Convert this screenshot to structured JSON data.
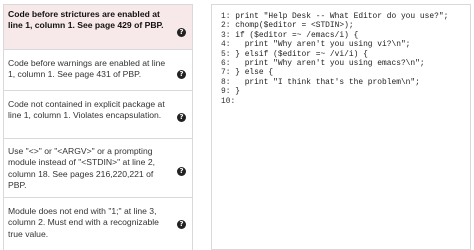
{
  "sidebar": {
    "items": [
      {
        "text": "Code before strictures are enabled at line 1, column 1. See page 429 of PBP.",
        "icon": "question-icon",
        "active": true
      },
      {
        "text": "Code before warnings are enabled at line 1, column 1. See page 431 of PBP.",
        "icon": "question-icon",
        "active": false
      },
      {
        "text": "Code not contained in explicit package at line 1, column 1. Violates encapsulation.",
        "icon": "question-icon",
        "active": false
      },
      {
        "text": "Use \"<>\" or \"<ARGV>\" or a prompting module instead of \"<STDIN>\" at line 2, column 18. See pages 216,220,221 of PBP.",
        "icon": "question-icon",
        "active": false
      },
      {
        "text": "Module does not end with \"1;\" at line 3, column 2. Must end with a recognizable true value.",
        "icon": "question-icon",
        "active": false
      }
    ]
  },
  "editor": {
    "lines": [
      {
        "num": "1:",
        "code": " print \"Help Desk -- What Editor do you use?\";"
      },
      {
        "num": "2:",
        "code": " chomp($editor = <STDIN>);"
      },
      {
        "num": "3:",
        "code": " if ($editor =~ /emacs/i) {"
      },
      {
        "num": "4:",
        "code": "   print \"Why aren't you using vi?\\n\";"
      },
      {
        "num": "5:",
        "code": " } elsif ($editor =~ /vi/i) {"
      },
      {
        "num": "6:",
        "code": "   print \"Why aren't you using emacs?\\n\";"
      },
      {
        "num": "7:",
        "code": " } else {"
      },
      {
        "num": "8:",
        "code": "   print \"I think that's the problem\\n\";"
      },
      {
        "num": "9:",
        "code": " }"
      },
      {
        "num": "10:",
        "code": ""
      }
    ]
  }
}
